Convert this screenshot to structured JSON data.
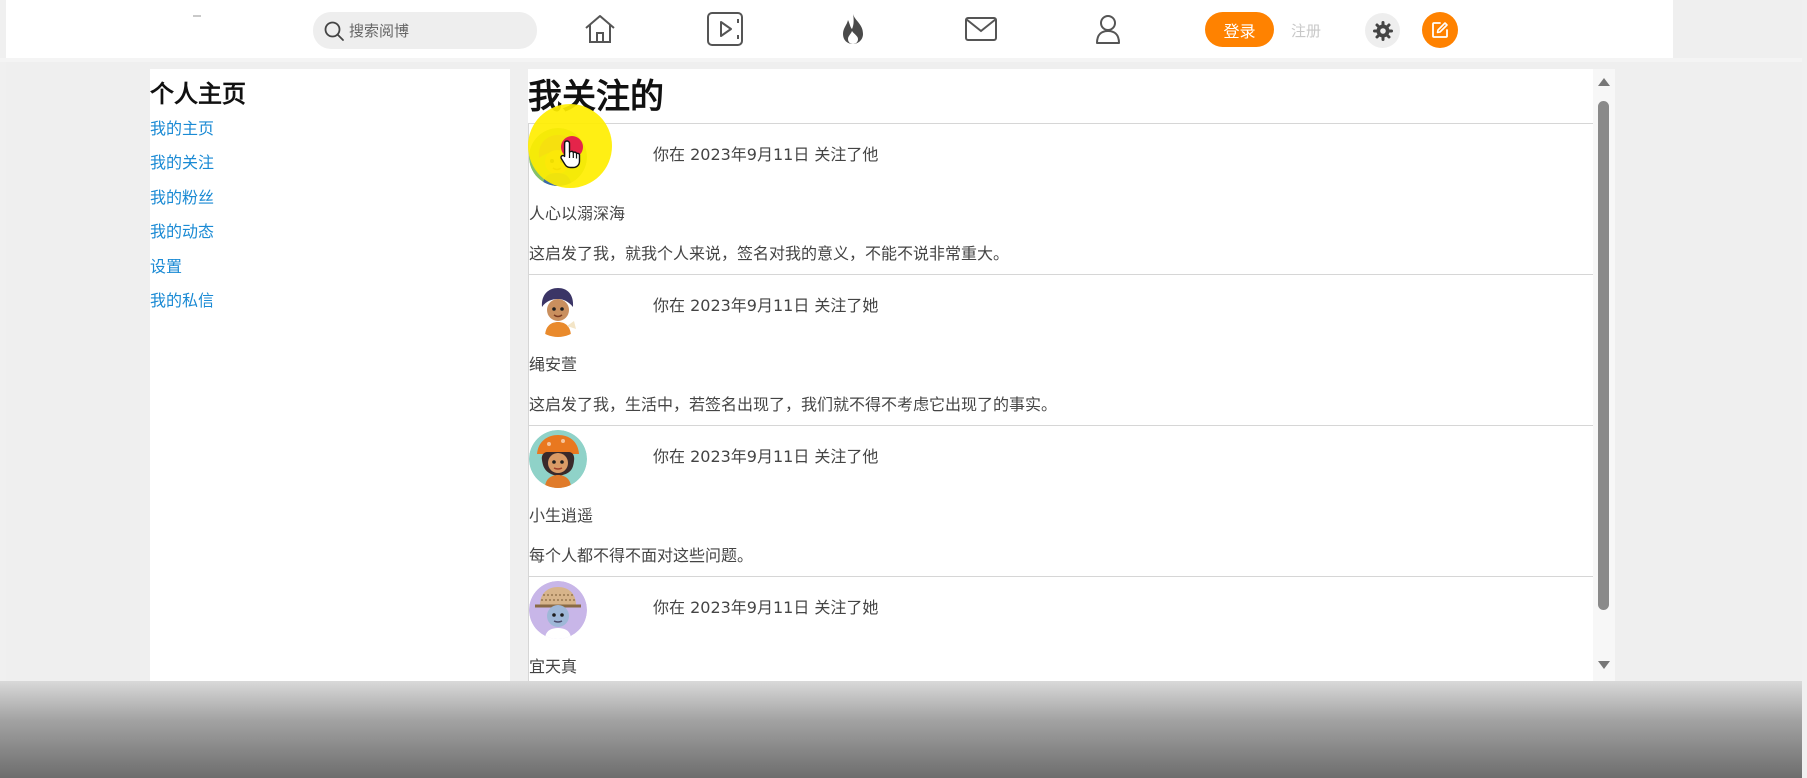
{
  "header": {
    "search_placeholder": "搜索阅博",
    "nav_icons": [
      "home-icon",
      "video-icon",
      "hot-icon",
      "mail-icon",
      "user-icon"
    ],
    "login_label": "登录",
    "register_label": "注册",
    "settings_icon": "gear-icon",
    "write_icon": "edit-icon",
    "accent_color": "#ff8200"
  },
  "sidebar": {
    "title": "个人主页",
    "links": [
      "我的主页",
      "我的关注",
      "我的粉丝",
      "我的动态",
      "设置",
      "我的私信"
    ],
    "link_color": "#1a8ad4"
  },
  "main": {
    "title": "我关注的",
    "follows": [
      {
        "avatar": "avatar-purple-hair-icon",
        "follow_text": "你在 2023年9月11日 关注了他",
        "username": "人心以溺深海",
        "bio": "这启发了我，就我个人来说，签名对我的意义，不能不说非常重大。"
      },
      {
        "avatar": "avatar-dark-hair-icon",
        "follow_text": "你在 2023年9月11日 关注了她",
        "username": "绳安萱",
        "bio": "这启发了我，生活中，若签名出现了，我们就不得不考虑它出现了的事实。"
      },
      {
        "avatar": "avatar-orange-hat-icon",
        "follow_text": "你在 2023年9月11日 关注了他",
        "username": "小生逍遥",
        "bio": "每个人都不得不面对这些问题。"
      },
      {
        "avatar": "avatar-straw-hat-icon",
        "follow_text": "你在 2023年9月11日 关注了她",
        "username": "宜天真",
        "bio": ""
      }
    ]
  }
}
